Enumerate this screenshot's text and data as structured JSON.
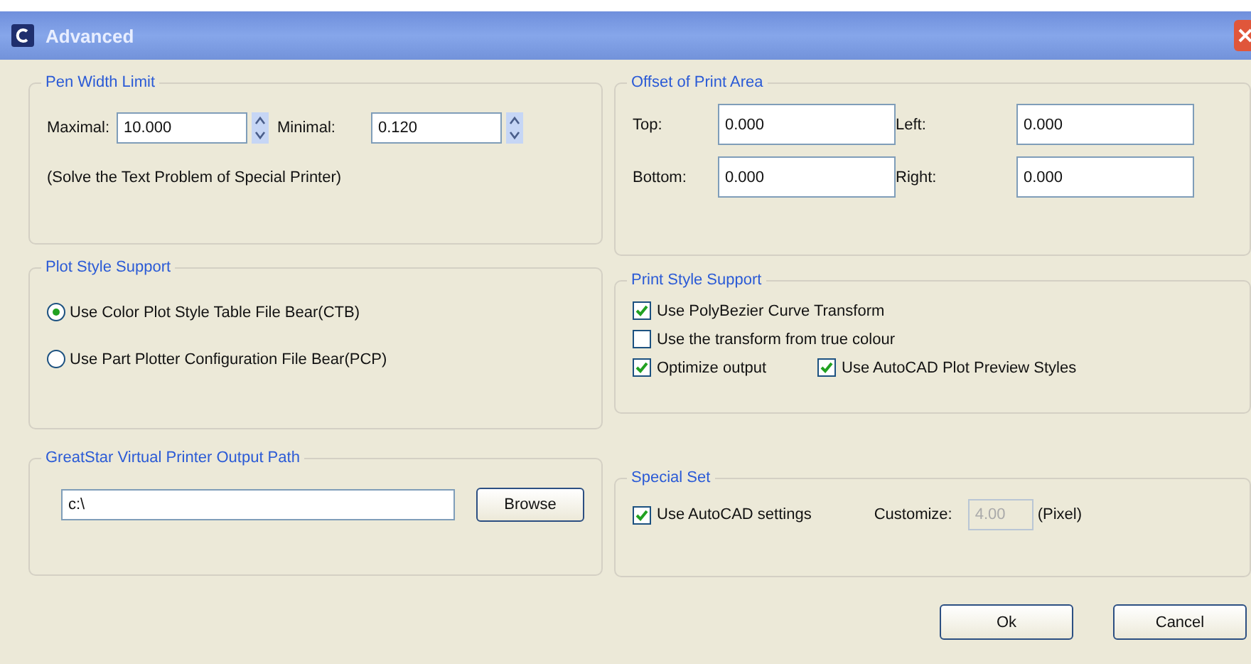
{
  "window": {
    "title": "Advanced"
  },
  "pen_width_limit": {
    "title": "Pen Width Limit",
    "maximal": {
      "label": "Maximal:",
      "value": "10.000"
    },
    "minimal": {
      "label": "Minimal:",
      "value": "0.120"
    },
    "note": "(Solve the Text Problem of Special Printer)"
  },
  "plot_style_support": {
    "title": "Plot Style Support",
    "options": [
      {
        "label": "Use Color Plot Style Table File Bear(CTB)",
        "selected": true
      },
      {
        "label": "Use Part Plotter Configuration File Bear(PCP)",
        "selected": false
      }
    ]
  },
  "output_path": {
    "title": "GreatStar Virtual Printer Output Path",
    "value": "c:\\",
    "button": "Browse"
  },
  "offset_of_print_area": {
    "title": "Offset of Print Area",
    "fields": [
      {
        "label": "Top:",
        "value": "0.000"
      },
      {
        "label": "Left:",
        "value": "0.000"
      },
      {
        "label": "Bottom:",
        "value": "0.000"
      },
      {
        "label": "Right:",
        "value": "0.000"
      }
    ]
  },
  "print_style_support": {
    "title": "Print Style Support",
    "rows": [
      [
        {
          "label": "Use PolyBezier Curve Transform",
          "checked": true
        }
      ],
      [
        {
          "label": "Use the transform from true colour",
          "checked": false
        }
      ],
      [
        {
          "label": "Optimize output",
          "checked": true
        },
        {
          "label": "Use AutoCAD Plot Preview Styles",
          "checked": true
        }
      ]
    ]
  },
  "special_set": {
    "title": "Special Set",
    "checkbox": {
      "label": "Use AutoCAD settings",
      "checked": true
    },
    "customize": {
      "label": "Customize:",
      "value": "4.00",
      "disabled": true,
      "unit": "(Pixel)"
    }
  },
  "buttons": [
    "Ok",
    "Cancel"
  ]
}
